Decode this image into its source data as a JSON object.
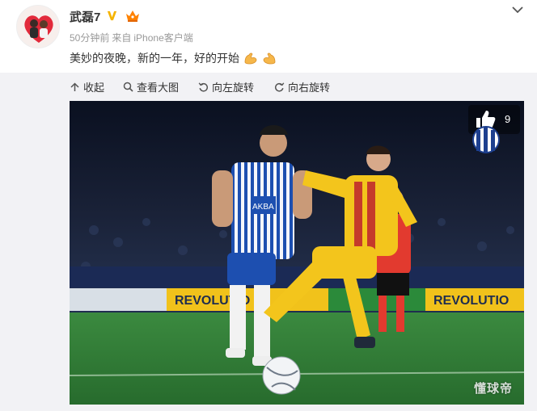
{
  "post": {
    "username": "武磊7",
    "time": "50分钟前",
    "source_prefix": "来自",
    "source": "iPhone客户端",
    "text": "美妙的夜晚，新的一年，好的开始",
    "icons": [
      "verified-icon",
      "vip-icon",
      "flexed-biceps-emoji",
      "chevron-down-icon"
    ]
  },
  "toolbar": {
    "collapse": "收起",
    "view_large": "查看大图",
    "rotate_left": "向左旋转",
    "rotate_right": "向右旋转"
  },
  "photo": {
    "board_texts": [
      "REVOLUTIO",
      "REVOLUTIO",
      "REVOLUTIO"
    ],
    "likes": "9",
    "watermark": "懂球帝",
    "sponsor_text": "AKBA"
  },
  "colors": {
    "accent": "#ff8200",
    "verified_gold": "#f5b400",
    "espanyol_blue": "#1d4fb0",
    "barca_yellow": "#f3c51c",
    "pitch_green": "#2f7a35"
  }
}
